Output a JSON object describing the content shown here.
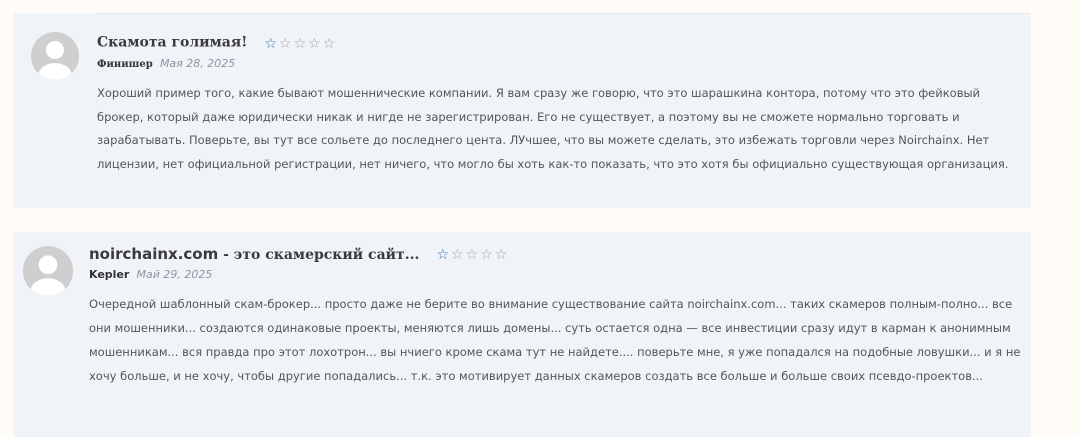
{
  "reviews": [
    {
      "title": "Скамота голимая!",
      "author": "Финишер",
      "date": "Мая 28, 2025",
      "rating": 1,
      "text": "Хороший пример того, какие бывают мошеннические компании. Я вам сразу же говорю, что это шарашкина контора, потому что это фейковый брокер, который даже юридически никак и нигде не зарегистрирован. Его не существует, а поэтому вы не сможете нормально торговать и зарабатывать. Поверьте, вы тут все сольете до последнего цента. ЛУчшее, что вы можете сделать, это избежать торговли через Noirchainx. Нет лицензии, нет официальной регистрации, нет ничего, что могло бы хоть как-то показать, что это хотя бы официально существующая организация."
    },
    {
      "title_site": "noirchainx.com",
      "title_rest": " - это скамерский сайт...",
      "author": "Kepler",
      "date": "Май 29, 2025",
      "rating": 1,
      "text": "Очередной шаблонный скам-брокер... просто даже не берите во внимание существование сайта noirchainx.com... таких скамеров полным-полно... все они мошенники... создаются одинаковые проекты, меняются лишь домены... суть остается одна — все инвестиции сразу идут в карман к анонимным мошенникам... вся правда про этот лохотрон... вы нчиего кроме скама тут не найдете.... поверьте мне, я уже попадался на подобные ловушки... и я не хочу больше, и не хочу, чтобы другие попадались... т.к. это мотивирует данных скамеров создать все больше и больше своих псевдо-проектов..."
    }
  ],
  "icons": {
    "avatar": "default-user-avatar-icon",
    "star_filled": "star-outline-active-icon",
    "star_empty": "star-outline-icon"
  },
  "colors": {
    "accent_star": "#2f6fb3",
    "card_bg": "#f0f4f8",
    "page_bg": "#fffbf7"
  }
}
